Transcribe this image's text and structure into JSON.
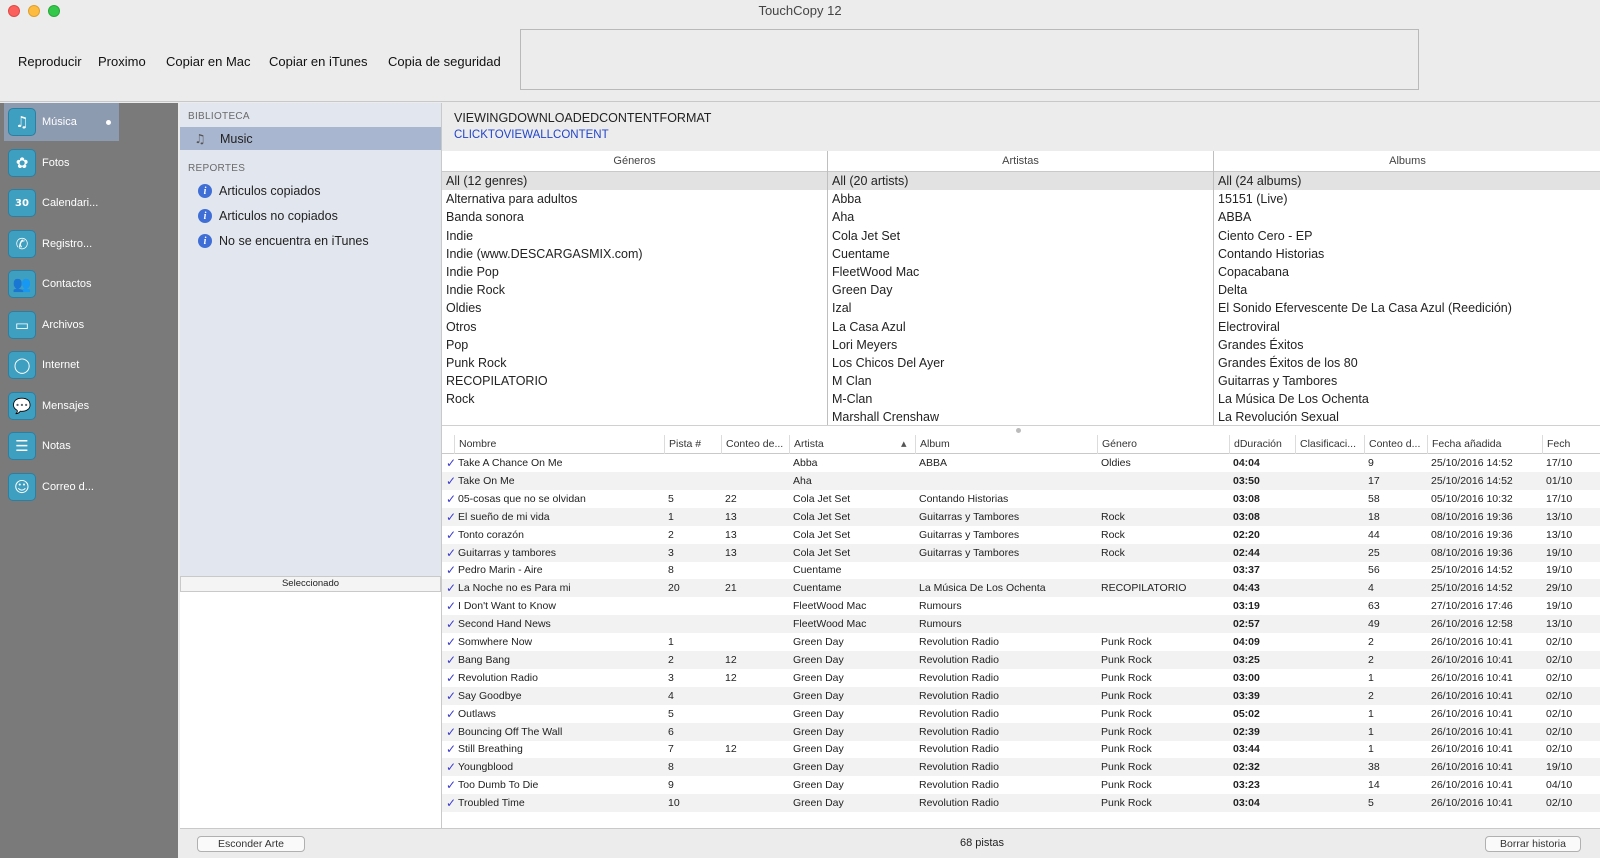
{
  "app_title": "TouchCopy 12",
  "toolbar": [
    "Reproducir",
    "Proximo",
    "Copiar en Mac",
    "Copiar en iTunes",
    "Copia de seguridad"
  ],
  "sidebar": [
    {
      "label": "Música",
      "icon": "music-note-icon",
      "glyph": "♫"
    },
    {
      "label": "Fotos",
      "icon": "flower-icon",
      "glyph": "✿"
    },
    {
      "label": "Calendari...",
      "icon": "calendar-icon",
      "glyph": "30"
    },
    {
      "label": "Registro...",
      "icon": "phone-icon",
      "glyph": "✆"
    },
    {
      "label": "Contactos",
      "icon": "contacts-icon",
      "glyph": "👥"
    },
    {
      "label": "Archivos",
      "icon": "folder-icon",
      "glyph": "▭"
    },
    {
      "label": "Internet",
      "icon": "globe-icon",
      "glyph": "◯"
    },
    {
      "label": "Mensajes",
      "icon": "speech-bubble-icon",
      "glyph": "💬"
    },
    {
      "label": "Notas",
      "icon": "notes-icon",
      "glyph": "☰"
    },
    {
      "label": "Correo d...",
      "icon": "voicemail-icon",
      "glyph": "☺"
    }
  ],
  "library": {
    "biblioteca_header": "BIBLIOTECA",
    "music_label": "Music",
    "reportes_header": "REPORTES",
    "reports": [
      "Articulos copiados",
      "Articulos no copiados",
      "No se encuentra en iTunes"
    ],
    "selected_header": "Seleccionado"
  },
  "view": {
    "title": "VIEWINGDOWNLOADEDCONTENTFORMAT",
    "link": "CLICKTOVIEWALLCONTENT"
  },
  "browser": {
    "genres": {
      "header": "Géneros",
      "items": [
        "All (12 genres)",
        "Alternativa para adultos",
        "Banda sonora",
        "Indie",
        "Indie (www.DESCARGASMIX.com)",
        "Indie Pop",
        "Indie Rock",
        "Oldies",
        "Otros",
        "Pop",
        "Punk Rock",
        "RECOPILATORIO",
        "Rock"
      ]
    },
    "artists": {
      "header": "Artistas",
      "items": [
        "All (20 artists)",
        "Abba",
        "Aha",
        "Cola Jet Set",
        "Cuentame",
        "FleetWood Mac",
        "Green Day",
        "Izal",
        "La Casa Azul",
        "Lori Meyers",
        "Los Chicos Del Ayer",
        "M Clan",
        "M-Clan",
        "Marshall Crenshaw"
      ]
    },
    "albums": {
      "header": "Albums",
      "items": [
        "All (24 albums)",
        "15151 (Live)",
        "ABBA",
        "Ciento Cero - EP",
        "Contando Historias",
        "Copacabana",
        "Delta",
        "El Sonido Efervescente De La Casa Azul (Reedición)",
        "Electroviral",
        "Grandes Éxitos",
        "Grandes Éxitos de los 80",
        "Guitarras y Tambores",
        "La Música De Los Ochenta",
        "La Revolución Sexual"
      ]
    }
  },
  "table": {
    "columns": [
      "Nombre",
      "Pista #",
      "Conteo de...",
      "Artista",
      "Album",
      "Género",
      "dDuración",
      "Clasificaci...",
      "Conteo d...",
      "Fecha añadida",
      "Fech"
    ],
    "rows": [
      [
        "Take A Chance On Me",
        "",
        "",
        "Abba",
        "ABBA",
        "Oldies",
        "04:04",
        "",
        "9",
        "25/10/2016 14:52",
        "17/10"
      ],
      [
        "Take On Me",
        "",
        "",
        "Aha",
        "",
        "",
        "03:50",
        "",
        "17",
        "25/10/2016 14:52",
        "01/10"
      ],
      [
        "05-cosas que no se olvidan",
        "5",
        "22",
        "Cola Jet Set",
        "Contando Historias",
        "",
        "03:08",
        "",
        "58",
        "05/10/2016 10:32",
        "17/10"
      ],
      [
        "El sueño de mi vida",
        "1",
        "13",
        "Cola Jet Set",
        "Guitarras y Tambores",
        "Rock",
        "03:08",
        "",
        "18",
        "08/10/2016 19:36",
        "13/10"
      ],
      [
        "Tonto corazón",
        "2",
        "13",
        "Cola Jet Set",
        "Guitarras y Tambores",
        "Rock",
        "02:20",
        "",
        "44",
        "08/10/2016 19:36",
        "13/10"
      ],
      [
        "Guitarras y tambores",
        "3",
        "13",
        "Cola Jet Set",
        "Guitarras y Tambores",
        "Rock",
        "02:44",
        "",
        "25",
        "08/10/2016 19:36",
        "19/10"
      ],
      [
        "Pedro Marin - Aire",
        "8",
        "",
        "Cuentame",
        "",
        "",
        "03:37",
        "",
        "56",
        "25/10/2016 14:52",
        "19/10"
      ],
      [
        " La Noche no es Para mi",
        "20",
        "21",
        "Cuentame",
        "La Música De Los Ochenta",
        "RECOPILATORIO",
        "04:43",
        "",
        "4",
        "25/10/2016 14:52",
        "29/10"
      ],
      [
        "I Don't Want to Know",
        "",
        "",
        "FleetWood Mac",
        "Rumours",
        "",
        "03:19",
        "",
        "63",
        "27/10/2016 17:46",
        "19/10"
      ],
      [
        "Second Hand News",
        "",
        "",
        "FleetWood Mac",
        "Rumours",
        "",
        "02:57",
        "",
        "49",
        "26/10/2016 12:58",
        "13/10"
      ],
      [
        "Somwhere Now",
        "1",
        "",
        "Green Day",
        "Revolution Radio",
        "Punk Rock",
        "04:09",
        "",
        "2",
        "26/10/2016 10:41",
        "02/10"
      ],
      [
        "Bang Bang",
        "2",
        "12",
        "Green Day",
        "Revolution Radio",
        "Punk Rock",
        "03:25",
        "",
        "2",
        "26/10/2016 10:41",
        "02/10"
      ],
      [
        "Revolution Radio",
        "3",
        "12",
        "Green Day",
        "Revolution Radio",
        "Punk Rock",
        "03:00",
        "",
        "1",
        "26/10/2016 10:41",
        "02/10"
      ],
      [
        "Say Goodbye",
        "4",
        "",
        "Green Day",
        "Revolution Radio",
        "Punk Rock",
        "03:39",
        "",
        "2",
        "26/10/2016 10:41",
        "02/10"
      ],
      [
        "Outlaws",
        "5",
        "",
        "Green Day",
        "Revolution Radio",
        "Punk Rock",
        "05:02",
        "",
        "1",
        "26/10/2016 10:41",
        "02/10"
      ],
      [
        "Bouncing Off The Wall",
        "6",
        "",
        "Green Day",
        "Revolution Radio",
        "Punk Rock",
        "02:39",
        "",
        "1",
        "26/10/2016 10:41",
        "02/10"
      ],
      [
        "Still Breathing",
        "7",
        "12",
        "Green Day",
        "Revolution Radio",
        "Punk Rock",
        "03:44",
        "",
        "1",
        "26/10/2016 10:41",
        "02/10"
      ],
      [
        "Youngblood",
        "8",
        "",
        "Green Day",
        "Revolution Radio",
        "Punk Rock",
        "02:32",
        "",
        "38",
        "26/10/2016 10:41",
        "19/10"
      ],
      [
        "Too Dumb To Die",
        "9",
        "",
        "Green Day",
        "Revolution Radio",
        "Punk Rock",
        "03:23",
        "",
        "14",
        "26/10/2016 10:41",
        "04/10"
      ],
      [
        "Troubled Time",
        "10",
        "",
        "Green Day",
        "Revolution Radio",
        "Punk Rock",
        "03:04",
        "",
        "5",
        "26/10/2016 10:41",
        "02/10"
      ]
    ]
  },
  "status": {
    "hide_art": "Esconder Arte",
    "count": "68 pistas",
    "clear_history": "Borrar historia"
  }
}
